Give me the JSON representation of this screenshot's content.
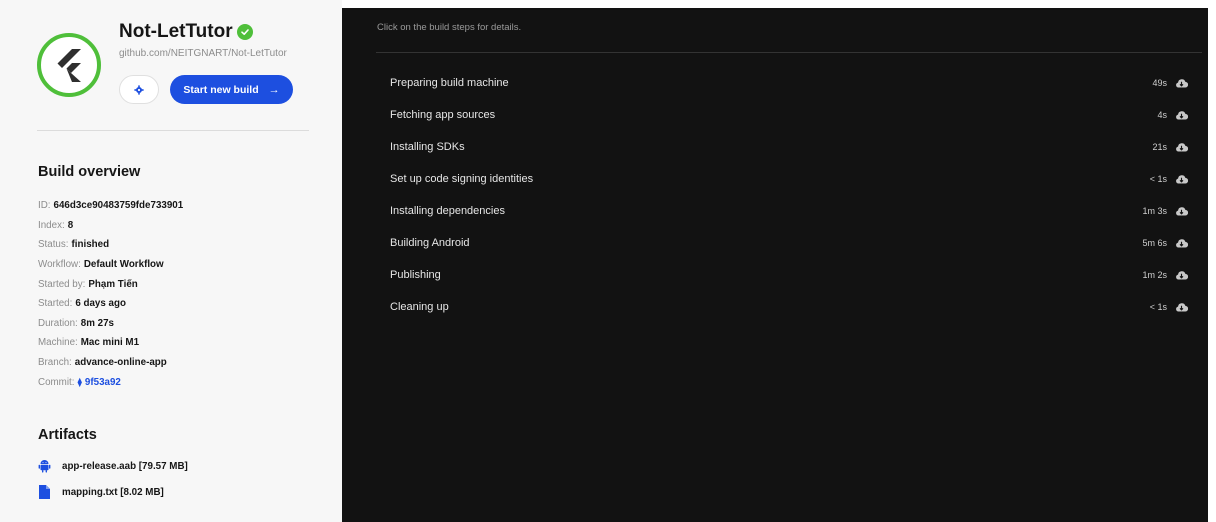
{
  "app": {
    "title": "Not-LetTutor",
    "repo": "github.com/NEITGNART/Not-LetTutor",
    "start_build_label": "Start new build",
    "start_build_arrow": "→"
  },
  "icons": {
    "logo": "flutter-logo",
    "verified": "check-circle-icon",
    "settings": "gear-icon",
    "commit": "commit-icon",
    "android": "android-icon",
    "file": "file-icon",
    "artifact_download": "cloud-download-icon"
  },
  "colors": {
    "accent": "#1d4fe0",
    "success": "#4fbf3a",
    "dark_panel": "#121212"
  },
  "overview": {
    "title": "Build overview",
    "rows": [
      {
        "k": "ID:",
        "v": "646d3ce90483759fde733901"
      },
      {
        "k": "Index:",
        "v": "8"
      },
      {
        "k": "Status:",
        "v": "finished"
      },
      {
        "k": "Workflow:",
        "v": "Default Workflow"
      },
      {
        "k": "Started by:",
        "v": "Phạm Tiến"
      },
      {
        "k": "Started:",
        "v": "6 days ago"
      },
      {
        "k": "Duration:",
        "v": "8m 27s"
      },
      {
        "k": "Machine:",
        "v": "Mac mini M1"
      },
      {
        "k": "Branch:",
        "v": "advance-online-app"
      },
      {
        "k": "Commit:",
        "v": "9f53a92"
      }
    ]
  },
  "artifacts": {
    "title": "Artifacts",
    "items": [
      {
        "label": "app-release.aab [79.57 MB]"
      },
      {
        "label": "mapping.txt [8.02 MB]"
      }
    ]
  },
  "steps_panel": {
    "hint": "Click on the build steps for details.",
    "steps": [
      {
        "name": "Preparing build machine",
        "duration": "49s"
      },
      {
        "name": "Fetching app sources",
        "duration": "4s"
      },
      {
        "name": "Installing SDKs",
        "duration": "21s"
      },
      {
        "name": "Set up code signing identities",
        "duration": "< 1s"
      },
      {
        "name": "Installing dependencies",
        "duration": "1m 3s"
      },
      {
        "name": "Building Android",
        "duration": "5m 6s"
      },
      {
        "name": "Publishing",
        "duration": "1m 2s"
      },
      {
        "name": "Cleaning up",
        "duration": "< 1s"
      }
    ]
  }
}
